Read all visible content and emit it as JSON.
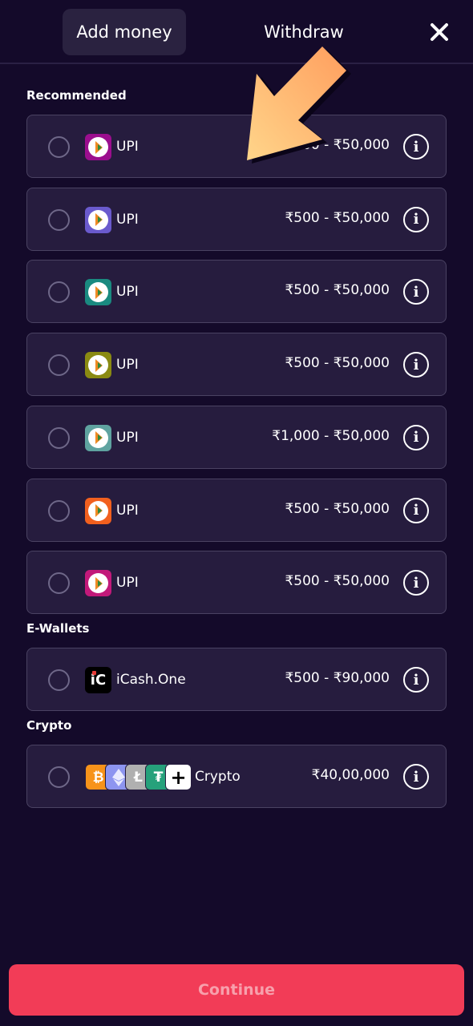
{
  "tabs": {
    "add_money": "Add money",
    "withdraw": "Withdraw"
  },
  "sections": {
    "recommended": "Recommended",
    "ewallets": "E-Wallets",
    "crypto": "Crypto"
  },
  "recommended_methods": [
    {
      "label": "UPI",
      "range": "₹500 - ₹50,000",
      "icon": "bhim-upi-icon",
      "icon_color": "#9b0e8e"
    },
    {
      "label": "UPI",
      "range": "₹500 - ₹50,000",
      "icon": "bhim-upi-icon",
      "icon_color": "#6a5acd"
    },
    {
      "label": "UPI",
      "range": "₹500 - ₹50,000",
      "icon": "bhim-upi-icon",
      "icon_color": "#1a8a80"
    },
    {
      "label": "UPI",
      "range": "₹500 - ₹50,000",
      "icon": "bhim-upi-icon",
      "icon_color": "#8a8a12"
    },
    {
      "label": "UPI",
      "range": "₹1,000 - ₹50,000",
      "icon": "bhim-upi-icon",
      "icon_color": "#5fa3a0"
    },
    {
      "label": "UPI",
      "range": "₹500 - ₹50,000",
      "icon": "bhim-upi-icon",
      "icon_color": "#f2601e"
    },
    {
      "label": "UPI",
      "range": "₹500 - ₹50,000",
      "icon": "bhim-upi-icon",
      "icon_color": "#c2197a"
    }
  ],
  "ewallet_method": {
    "label": "iCash.One",
    "range": "₹500 - ₹90,000",
    "logo_text": "iC"
  },
  "crypto_method": {
    "label": "Crypto",
    "range": "₹40,00,000"
  },
  "continue_label": "Continue",
  "colors": {
    "background": "#140a2a",
    "card": "#261c3e",
    "accent": "#f23c57",
    "arrow": "#ffb97a"
  }
}
